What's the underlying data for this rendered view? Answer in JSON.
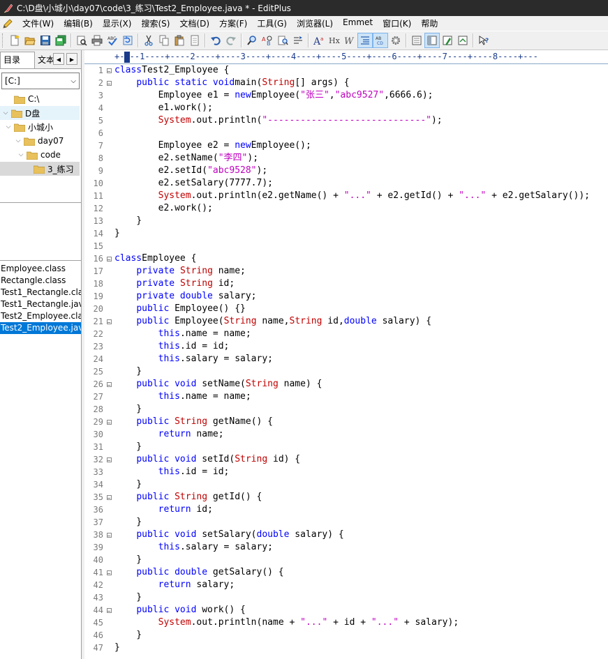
{
  "window": {
    "title": "C:\\D盘\\小城小\\day07\\code\\3_练习\\Test2_Employee.java * - EditPlus"
  },
  "menu": [
    "文件(W)",
    "编辑(B)",
    "显示(X)",
    "搜索(S)",
    "文档(D)",
    "方案(F)",
    "工具(G)",
    "浏览器(L)",
    "Emmet",
    "窗口(K)",
    "帮助"
  ],
  "toolbar": {
    "buttons": [
      "new-file",
      "open",
      "save",
      "save-all",
      "print-preview",
      "print",
      "spell-check",
      "refresh",
      "cut",
      "copy",
      "paste",
      "delete",
      "undo",
      "redo",
      "find",
      "replace",
      "find-in-files",
      "goto",
      "font-a",
      "hx",
      "word-wrap",
      "line-numbers",
      "indent-guides",
      "settings",
      "view-1",
      "view-2",
      "view-3",
      "view-4",
      "help"
    ]
  },
  "left_panel": {
    "tabs": [
      "目录",
      "文本"
    ],
    "drive": "[C:]",
    "tree": [
      {
        "label": "C:\\",
        "level": 0
      },
      {
        "label": "D盘",
        "level": 0
      },
      {
        "label": "小城小",
        "level": 1
      },
      {
        "label": "day07",
        "level": 2
      },
      {
        "label": "code",
        "level": 3
      },
      {
        "label": "3_练习",
        "level": 4
      }
    ],
    "files": [
      "Employee.class",
      "Rectangle.class",
      "Test1_Rectangle.cla",
      "Test1_Rectangle.jav",
      "Test2_Employee.cla",
      "Test2_Employee.jav"
    ],
    "selected_file": "Test2_Employee.jav"
  },
  "ruler": {
    "text": "+----1----+----2----+----3----+----4----+----5----+----6----+----7----+----8----+---"
  },
  "editor": {
    "lines": [
      [
        [
          "kw",
          "class"
        ],
        [
          "",
          "Test2_Employee {"
        ]
      ],
      [
        [
          "",
          "    "
        ],
        [
          "kw",
          "public static void"
        ],
        [
          "",
          "main("
        ],
        [
          "ty",
          "String"
        ],
        [
          "",
          "[] args) {"
        ]
      ],
      [
        [
          "",
          "        Employee e1 = "
        ],
        [
          "kw",
          "new"
        ],
        [
          "",
          "Employee("
        ],
        [
          "st",
          "\"张三\""
        ],
        [
          "",
          ","
        ],
        [
          "st",
          "\"abc9527\""
        ],
        [
          "",
          ",6666.6);"
        ]
      ],
      [
        [
          "",
          "        e1.work();"
        ]
      ],
      [
        [
          "",
          "        "
        ],
        [
          "sys",
          "System"
        ],
        [
          "",
          ".out.println("
        ],
        [
          "st",
          "\"-----------------------------\""
        ],
        [
          "",
          ");"
        ]
      ],
      [
        [
          "",
          ""
        ]
      ],
      [
        [
          "",
          "        Employee e2 = "
        ],
        [
          "kw",
          "new"
        ],
        [
          "",
          "Employee();"
        ]
      ],
      [
        [
          "",
          "        e2.setName("
        ],
        [
          "st",
          "\"李四\""
        ],
        [
          "",
          ");"
        ]
      ],
      [
        [
          "",
          "        e2.setId("
        ],
        [
          "st",
          "\"abc9528\""
        ],
        [
          "",
          ");"
        ]
      ],
      [
        [
          "",
          "        e2.setSalary(7777.7);"
        ]
      ],
      [
        [
          "",
          "        "
        ],
        [
          "sys",
          "System"
        ],
        [
          "",
          ".out.println(e2.getName() + "
        ],
        [
          "st",
          "\"...\""
        ],
        [
          "",
          " + e2.getId() + "
        ],
        [
          "st",
          "\"...\""
        ],
        [
          "",
          " + e2.getSalary());"
        ]
      ],
      [
        [
          "",
          "        e2.work();"
        ]
      ],
      [
        [
          "",
          "    }"
        ]
      ],
      [
        [
          "",
          "}"
        ]
      ],
      [
        [
          "",
          ""
        ]
      ],
      [
        [
          "kw",
          "class"
        ],
        [
          "",
          "Employee {"
        ]
      ],
      [
        [
          "",
          "    "
        ],
        [
          "kw",
          "private"
        ],
        [
          "",
          " "
        ],
        [
          "ty",
          "String"
        ],
        [
          "",
          " name;"
        ]
      ],
      [
        [
          "",
          "    "
        ],
        [
          "kw",
          "private"
        ],
        [
          "",
          " "
        ],
        [
          "ty",
          "String"
        ],
        [
          "",
          " id;"
        ]
      ],
      [
        [
          "",
          "    "
        ],
        [
          "kw",
          "private double"
        ],
        [
          "",
          " salary;"
        ]
      ],
      [
        [
          "",
          "    "
        ],
        [
          "kw",
          "public"
        ],
        [
          "",
          " Employee() {}"
        ]
      ],
      [
        [
          "",
          "    "
        ],
        [
          "kw",
          "public"
        ],
        [
          "",
          " Employee("
        ],
        [
          "ty",
          "String"
        ],
        [
          "",
          " name,"
        ],
        [
          "ty",
          "String"
        ],
        [
          "",
          " id,"
        ],
        [
          "kw",
          "double"
        ],
        [
          "",
          " salary) {"
        ]
      ],
      [
        [
          "",
          "        "
        ],
        [
          "kw",
          "this"
        ],
        [
          "",
          ".name = name;"
        ]
      ],
      [
        [
          "",
          "        "
        ],
        [
          "kw",
          "this"
        ],
        [
          "",
          ".id = id;"
        ]
      ],
      [
        [
          "",
          "        "
        ],
        [
          "kw",
          "this"
        ],
        [
          "",
          ".salary = salary;"
        ]
      ],
      [
        [
          "",
          "    }"
        ]
      ],
      [
        [
          "",
          "    "
        ],
        [
          "kw",
          "public void"
        ],
        [
          "",
          " setName("
        ],
        [
          "ty",
          "String"
        ],
        [
          "",
          " name) {"
        ]
      ],
      [
        [
          "",
          "        "
        ],
        [
          "kw",
          "this"
        ],
        [
          "",
          ".name = name;"
        ]
      ],
      [
        [
          "",
          "    }"
        ]
      ],
      [
        [
          "",
          "    "
        ],
        [
          "kw",
          "public"
        ],
        [
          "",
          " "
        ],
        [
          "ty",
          "String"
        ],
        [
          "",
          " getName() {"
        ]
      ],
      [
        [
          "",
          "        "
        ],
        [
          "kw",
          "return"
        ],
        [
          "",
          " name;"
        ]
      ],
      [
        [
          "",
          "    }"
        ]
      ],
      [
        [
          "",
          "    "
        ],
        [
          "kw",
          "public void"
        ],
        [
          "",
          " setId("
        ],
        [
          "ty",
          "String"
        ],
        [
          "",
          " id) {"
        ]
      ],
      [
        [
          "",
          "        "
        ],
        [
          "kw",
          "this"
        ],
        [
          "",
          ".id = id;"
        ]
      ],
      [
        [
          "",
          "    }"
        ]
      ],
      [
        [
          "",
          "    "
        ],
        [
          "kw",
          "public"
        ],
        [
          "",
          " "
        ],
        [
          "ty",
          "String"
        ],
        [
          "",
          " getId() {"
        ]
      ],
      [
        [
          "",
          "        "
        ],
        [
          "kw",
          "return"
        ],
        [
          "",
          " id;"
        ]
      ],
      [
        [
          "",
          "    }"
        ]
      ],
      [
        [
          "",
          "    "
        ],
        [
          "kw",
          "public void"
        ],
        [
          "",
          " setSalary("
        ],
        [
          "kw",
          "double"
        ],
        [
          "",
          " salary) {"
        ]
      ],
      [
        [
          "",
          "        "
        ],
        [
          "kw",
          "this"
        ],
        [
          "",
          ".salary = salary;"
        ]
      ],
      [
        [
          "",
          "    }"
        ]
      ],
      [
        [
          "",
          "    "
        ],
        [
          "kw",
          "public double"
        ],
        [
          "",
          " getSalary() {"
        ]
      ],
      [
        [
          "",
          "        "
        ],
        [
          "kw",
          "return"
        ],
        [
          "",
          " salary;"
        ]
      ],
      [
        [
          "",
          "    }"
        ]
      ],
      [
        [
          "",
          "    "
        ],
        [
          "kw",
          "public void"
        ],
        [
          "",
          " work() {"
        ]
      ],
      [
        [
          "",
          "        "
        ],
        [
          "sys",
          "System"
        ],
        [
          "",
          ".out.println(name + "
        ],
        [
          "st",
          "\"...\""
        ],
        [
          "",
          " + id + "
        ],
        [
          "st",
          "\"...\""
        ],
        [
          "",
          " + salary);"
        ]
      ],
      [
        [
          "",
          "    }"
        ]
      ],
      [
        [
          "",
          "}"
        ]
      ]
    ],
    "fold_lines": [
      1,
      2,
      16,
      21,
      26,
      29,
      32,
      35,
      38,
      41,
      44
    ]
  },
  "colors": {
    "keyword": "#0000ff",
    "type": "#c00000",
    "string": "#c000c0",
    "selection": "#0078d7"
  }
}
